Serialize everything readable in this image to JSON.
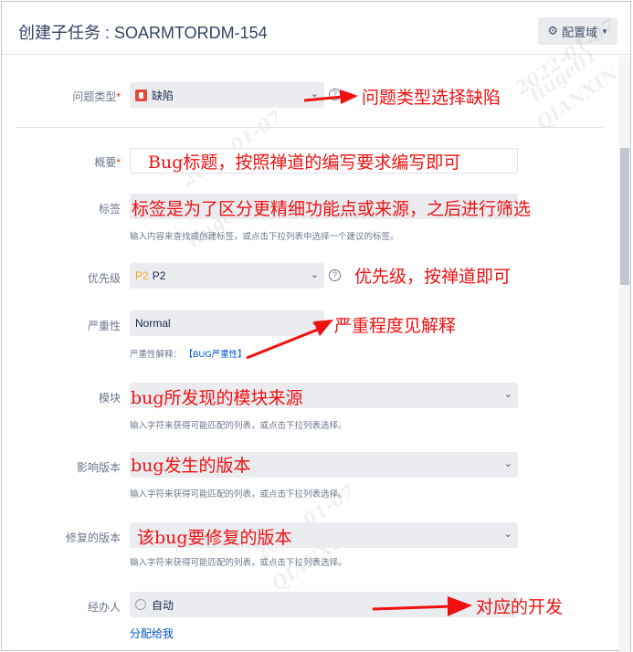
{
  "dialog": {
    "title": "创建子任务 : SOARMTORDM-154",
    "config_button": "配置域",
    "config_icon": "gear-icon"
  },
  "fields": {
    "issue_type": {
      "label": "问题类型",
      "value": "缺陷",
      "icon": "bug-icon"
    },
    "summary": {
      "label": "概要",
      "value": ""
    },
    "labels": {
      "label": "标签",
      "value": "",
      "hint": "输入内容来查找或创建标签，或点击下拉列表中选择一个建议的标签。"
    },
    "priority": {
      "label": "优先级",
      "badge": "P2",
      "value": "P2",
      "badge_color": "#f5a623"
    },
    "severity": {
      "label": "严重性",
      "value": "Normal",
      "hint_prefix": "严重性解释：",
      "hint_link": "【BUG严重性】"
    },
    "module": {
      "label": "模块",
      "value": "",
      "hint": "输入字符来获得可能匹配的列表，或点击下拉列表选择。"
    },
    "affects_version": {
      "label": "影响版本",
      "value": "",
      "hint": "输入字符来获得可能匹配的列表，或点击下拉列表选择。"
    },
    "fix_version": {
      "label": "修复的版本",
      "value": "",
      "hint": "输入字符来获得可能匹配的列表，或点击下拉列表选择。"
    },
    "assignee": {
      "label": "经办人",
      "value": "自动",
      "assign_to_me": "分配给我"
    }
  },
  "annotations": {
    "issue_type": "问题类型选择缺陷",
    "summary": "Bug标题，按照禅道的编写要求编写即可",
    "labels": "标签是为了区分更精细功能点或来源，之后进行筛选",
    "priority": "优先级，按禅道即可",
    "severity": "严重程度见解释",
    "module": "bug所发现的模块来源",
    "affects_version": "bug发生的版本",
    "fix_version": "该bug要修复的版本",
    "assignee": "对应的开发"
  },
  "watermark": [
    "2022-01-07",
    "liuge01",
    "QIANXIN"
  ],
  "colors": {
    "annotation": "#f01010",
    "link": "#0052cc",
    "required": "#de350b"
  }
}
